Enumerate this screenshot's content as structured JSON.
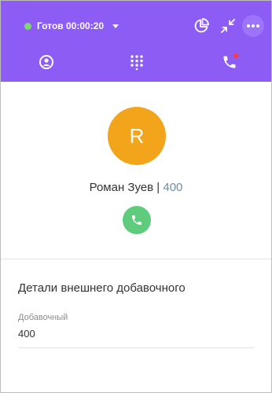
{
  "header": {
    "status_label": "Готов 00:00:20",
    "status_color": "#7fd86b",
    "accent": "#8c5cf5",
    "buttons": {
      "stats_icon": "pie-chart-icon",
      "collapse_icon": "collapse-icon",
      "more_icon": "more-icon"
    },
    "tabs": [
      {
        "icon": "contact-icon"
      },
      {
        "icon": "dialpad-icon"
      },
      {
        "icon": "missed-call-icon",
        "has_notification": true
      }
    ]
  },
  "contact": {
    "initial": "R",
    "name": "Роман Зуев",
    "separator": "|",
    "extension": "400",
    "avatar_color": "#f2a41b",
    "call_button_color": "#5ecb7d"
  },
  "details": {
    "title": "Детали внешнего добавочного",
    "field_label": "Добавочный",
    "field_value": "400"
  }
}
